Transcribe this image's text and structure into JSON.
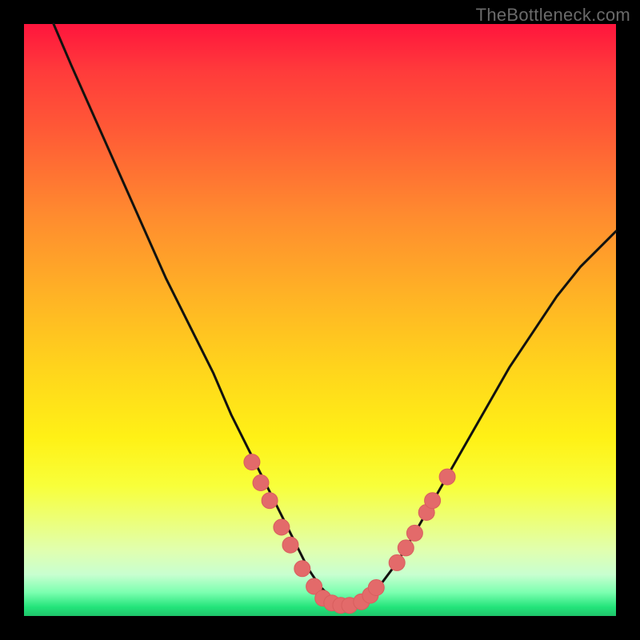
{
  "watermark": "TheBottleneck.com",
  "colors": {
    "frame": "#000000",
    "curve_stroke": "#12120f",
    "marker_fill": "#e36a6a",
    "marker_stroke": "#d85e5e"
  },
  "chart_data": {
    "type": "line",
    "title": "",
    "xlabel": "",
    "ylabel": "",
    "xlim": [
      0,
      100
    ],
    "ylim": [
      0,
      100
    ],
    "grid": false,
    "series": [
      {
        "name": "bottleneck-curve",
        "x": [
          5,
          8,
          12,
          16,
          20,
          24,
          28,
          32,
          35,
          38,
          41,
          44,
          46,
          48,
          50,
          52,
          54,
          56,
          58,
          60,
          63,
          66,
          70,
          74,
          78,
          82,
          86,
          90,
          94,
          98,
          100
        ],
        "y": [
          100,
          93,
          84,
          75,
          66,
          57,
          49,
          41,
          34,
          28,
          22,
          16,
          12,
          8,
          5,
          3,
          2,
          2,
          3,
          5,
          9,
          14,
          21,
          28,
          35,
          42,
          48,
          54,
          59,
          63,
          65
        ]
      }
    ],
    "markers": [
      {
        "group": "left-cluster",
        "points": [
          {
            "x": 38.5,
            "y": 26.0
          },
          {
            "x": 40.0,
            "y": 22.5
          },
          {
            "x": 41.5,
            "y": 19.5
          },
          {
            "x": 43.5,
            "y": 15.0
          },
          {
            "x": 45.0,
            "y": 12.0
          },
          {
            "x": 47.0,
            "y": 8.0
          },
          {
            "x": 49.0,
            "y": 5.0
          }
        ]
      },
      {
        "group": "trough-cluster",
        "points": [
          {
            "x": 50.5,
            "y": 3.0
          },
          {
            "x": 52.0,
            "y": 2.2
          },
          {
            "x": 53.5,
            "y": 1.8
          },
          {
            "x": 55.0,
            "y": 1.8
          },
          {
            "x": 57.0,
            "y": 2.4
          },
          {
            "x": 58.5,
            "y": 3.5
          },
          {
            "x": 59.5,
            "y": 4.8
          }
        ]
      },
      {
        "group": "right-cluster",
        "points": [
          {
            "x": 63.0,
            "y": 9.0
          },
          {
            "x": 64.5,
            "y": 11.5
          },
          {
            "x": 66.0,
            "y": 14.0
          },
          {
            "x": 68.0,
            "y": 17.5
          },
          {
            "x": 69.0,
            "y": 19.5
          },
          {
            "x": 71.5,
            "y": 23.5
          }
        ]
      }
    ]
  }
}
